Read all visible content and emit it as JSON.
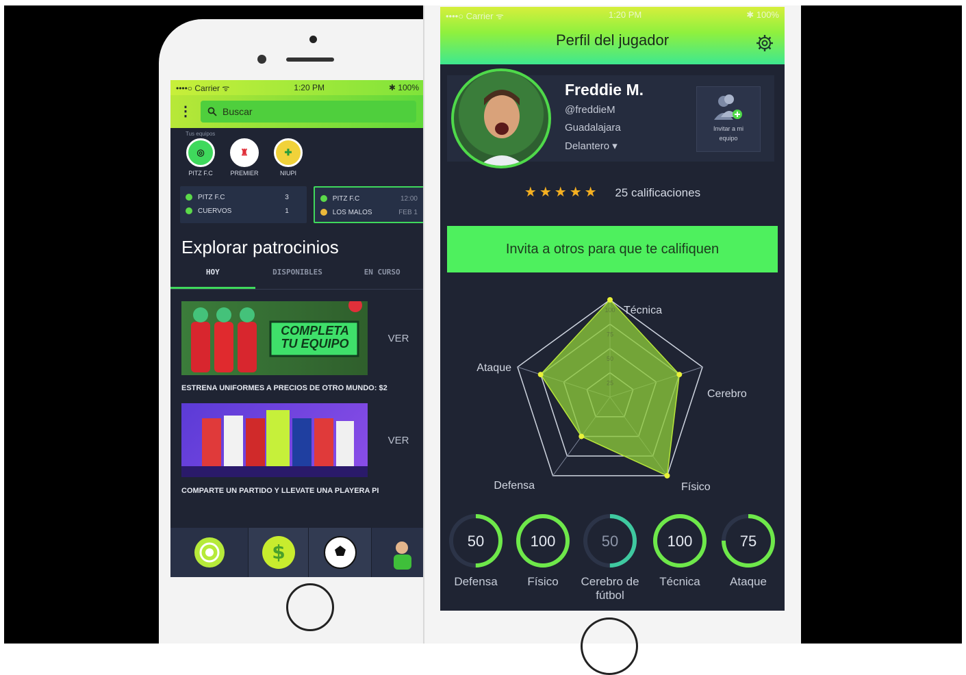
{
  "left": {
    "status": {
      "carrier": "••••○ Carrier ᯤ",
      "time": "1:20 PM",
      "battery": "✱ 100%"
    },
    "search_placeholder": "Buscar",
    "teams_label": "Tus equipos",
    "teams": [
      {
        "name": "PITZ F.C",
        "color": "#3fd95c"
      },
      {
        "name": "PREMIER",
        "color": "#e0303a"
      },
      {
        "name": "NIUPI",
        "color": "#3fd95c"
      }
    ],
    "matches": [
      {
        "team1": "PITZ F.C",
        "score1": "3",
        "team2": "CUERVOS",
        "score2": "1"
      },
      {
        "team1": "PITZ F.C",
        "score1": "12:00",
        "team2": "LOS MALOS",
        "score2": "FEB 1"
      }
    ],
    "section_title": "Explorar patrocinios",
    "tabs": [
      "HOY",
      "DISPONIBLES",
      "EN CURSO"
    ],
    "promos": [
      {
        "banner": "COMPLETA TU EQUIPO",
        "action": "VER",
        "caption": "ESTRENA UNIFORMES A PRECIOS DE OTRO MUNDO: $2"
      },
      {
        "action": "VER",
        "caption": "COMPARTE UN PARTIDO Y LLEVATE UNA  PLAYERA PI"
      }
    ],
    "nav_icons": [
      "team-crest",
      "dollar",
      "soccer-ball",
      "player-avatar"
    ]
  },
  "right": {
    "status": {
      "carrier": "••••○ Carrier ᯤ",
      "time": "1:20 PM",
      "battery": "✱ 100%"
    },
    "title": "Perfil del jugador",
    "player": {
      "name": "Freddie M.",
      "handle": "@freddieM",
      "city": "Guadalajara",
      "position": "Delantero ▾"
    },
    "invite_box": "Invitar a mi equipo",
    "rating_stars": 5,
    "rating_text": "25  calificaciones",
    "invite_button": "Invita a otros para que te califiquen",
    "radar": {
      "labels": [
        "Técnica",
        "Cerebro",
        "Físico",
        "Defensa",
        "Ataque"
      ],
      "ticks": [
        "100",
        "75",
        "50",
        "25"
      ],
      "values": [
        100,
        75,
        100,
        50,
        75
      ]
    },
    "stats": [
      {
        "value": "50",
        "label": "Defensa",
        "pct": 0.5,
        "dim": false
      },
      {
        "value": "100",
        "label": "Físico",
        "pct": 1.0,
        "dim": false
      },
      {
        "value": "50",
        "label": "Cerebro de fútbol",
        "pct": 0.5,
        "dim": true
      },
      {
        "value": "100",
        "label": "Técnica",
        "pct": 1.0,
        "dim": false
      },
      {
        "value": "75",
        "label": "Ataque",
        "pct": 0.75,
        "dim": false
      }
    ],
    "colors": {
      "accent": "#4ef05e",
      "bg": "#1f2433",
      "star": "#f5b021"
    }
  }
}
